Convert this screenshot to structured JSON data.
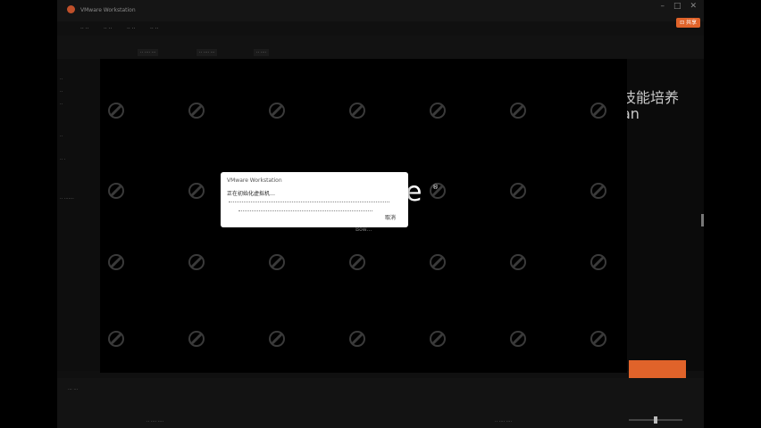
{
  "window": {
    "title": "VMware Workstation",
    "share_label": "⊡ 共享"
  },
  "background_slide": {
    "title_fragment": "技能培养",
    "subtitle_fragment": "an"
  },
  "vm": {
    "brand_letter": "e",
    "brand_mark": "®",
    "loading_text": "Bow…"
  },
  "dialog": {
    "title": "VMware Workstation",
    "message": "正在初始化虚拟机…",
    "cancel_label": "取消"
  },
  "status_bar": {
    "zoom_percent": 50
  },
  "colors": {
    "accent": "#e0632a",
    "dialog_bg": "#ffffff",
    "screen_bg": "#000000"
  }
}
